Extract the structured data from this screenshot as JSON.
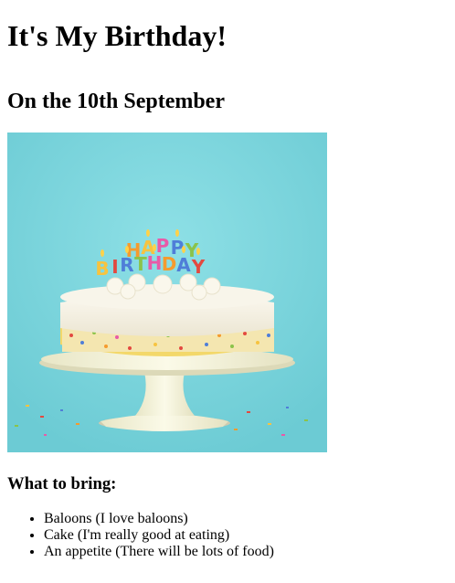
{
  "page": {
    "title": "It's My Birthday!",
    "subtitle": "On the 10th September",
    "image_label": "HAPPY BIRTHDAY",
    "list_heading": "What to bring:",
    "items": [
      "Baloons (I love baloons)",
      "Cake (I'm really good at eating)",
      "An appetite (There will be lots of food)"
    ]
  },
  "colors": {
    "background": "#ffffff",
    "text": "#000000",
    "photo_background": "#79d5dc",
    "cake_frosting": "#f4f0e4",
    "cake_stand": "#f4f2d8"
  }
}
